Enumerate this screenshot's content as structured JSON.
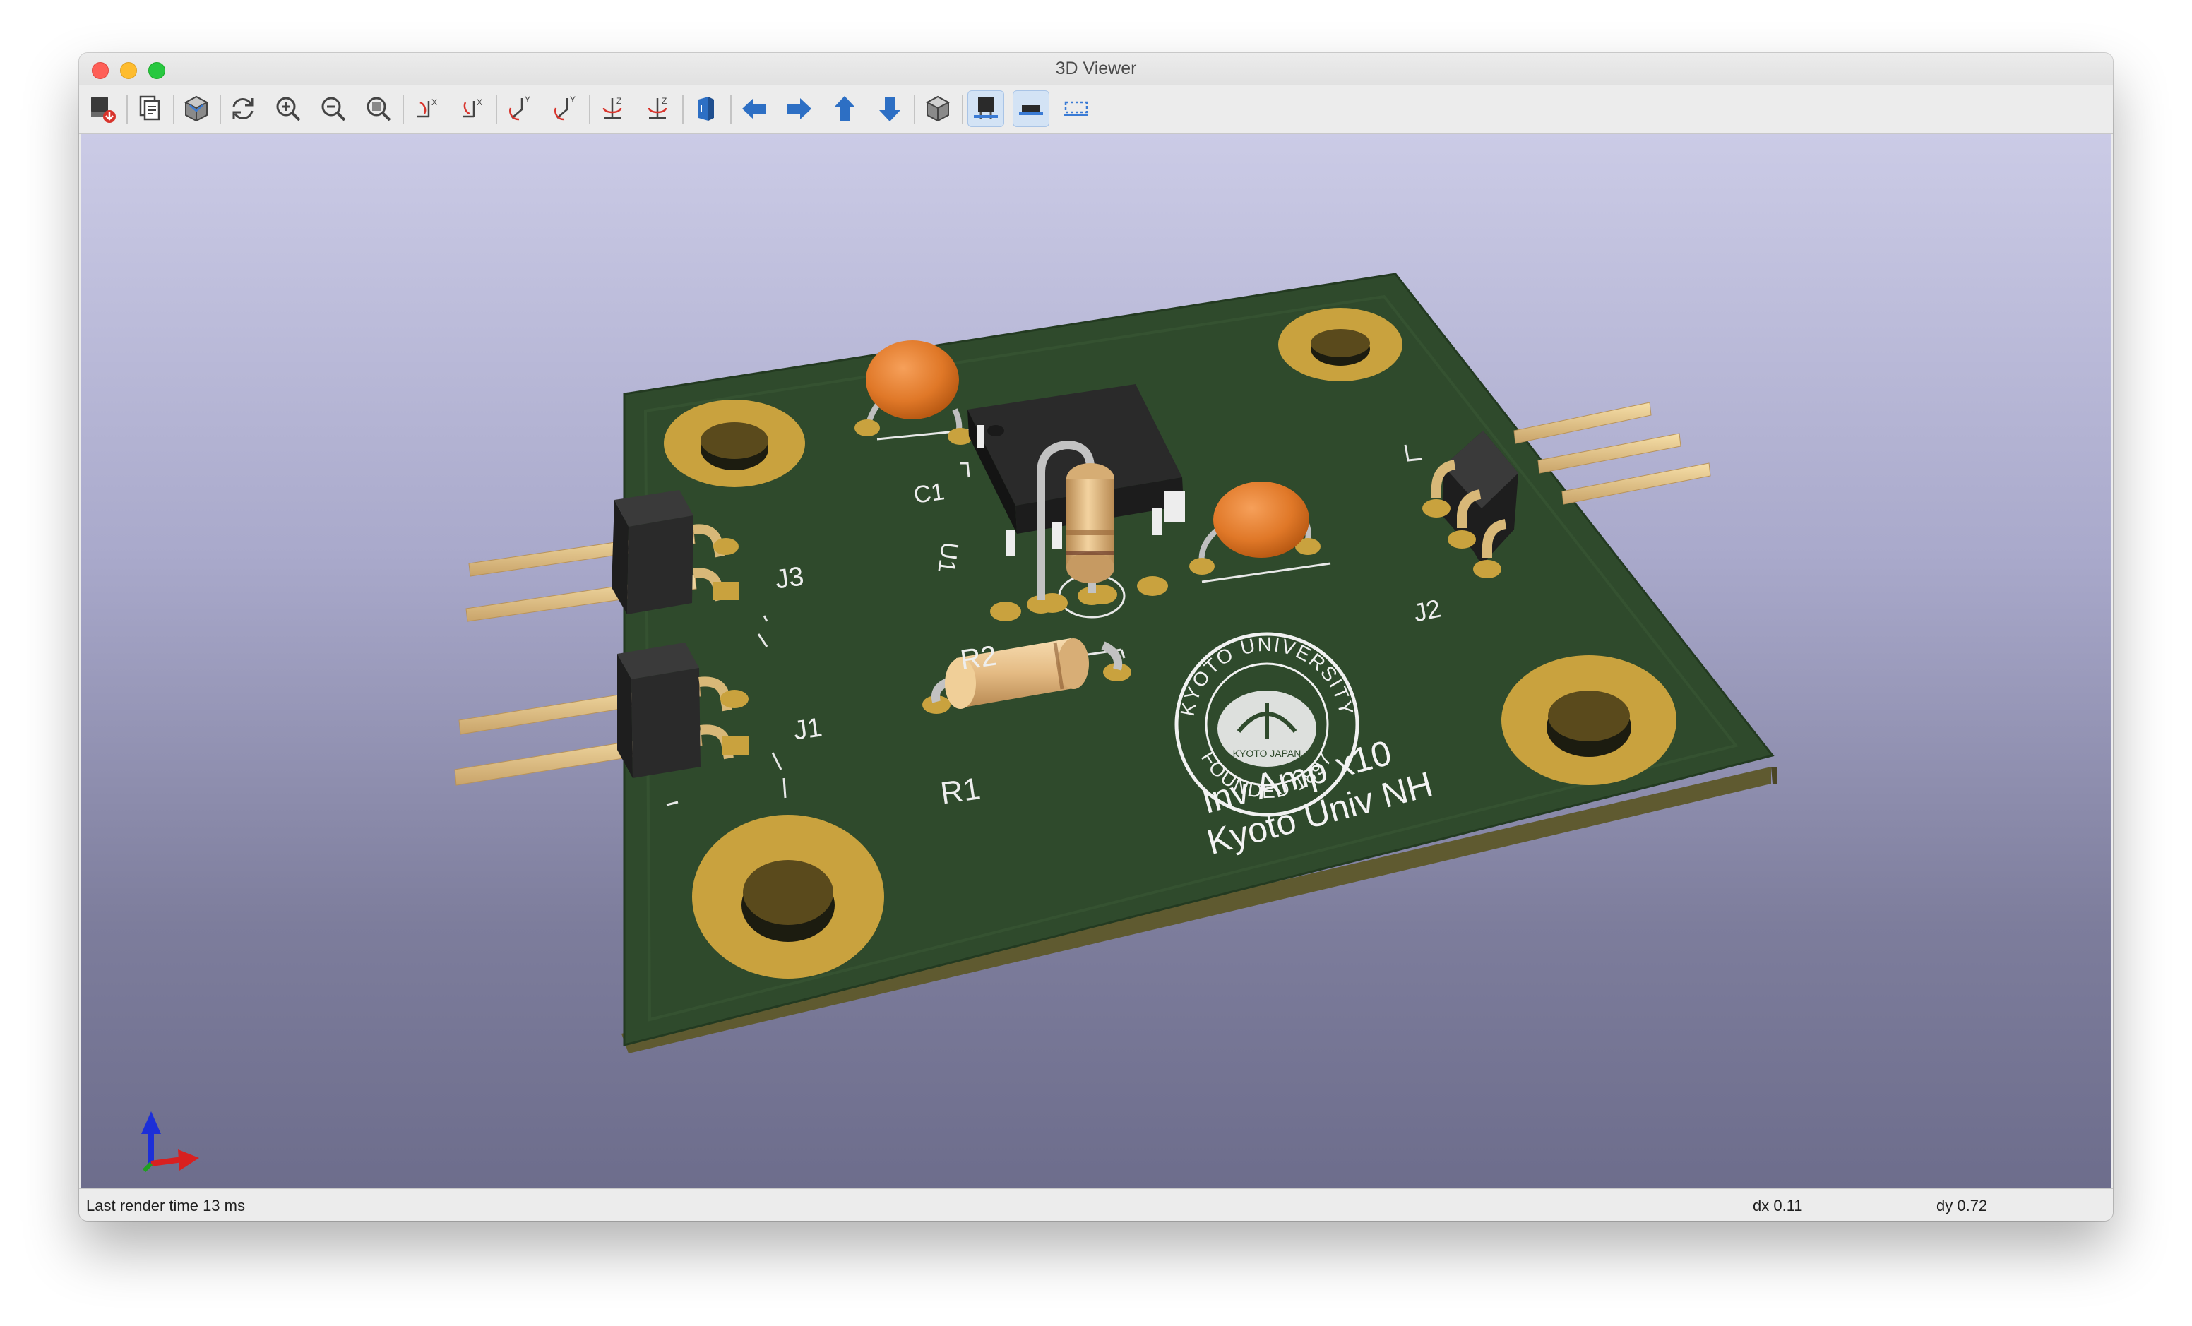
{
  "window": {
    "title": "3D Viewer"
  },
  "toolbar": {
    "buttons": [
      {
        "name": "export-image-icon"
      },
      {
        "name": "copy-clipboard-icon"
      },
      {
        "name": "raytrace-render-icon"
      },
      {
        "name": "reload-icon"
      },
      {
        "name": "zoom-in-icon"
      },
      {
        "name": "zoom-out-icon"
      },
      {
        "name": "zoom-fit-icon"
      },
      {
        "name": "rotate-x-cw-icon"
      },
      {
        "name": "rotate-x-ccw-icon"
      },
      {
        "name": "rotate-y-cw-icon"
      },
      {
        "name": "rotate-y-ccw-icon"
      },
      {
        "name": "rotate-z-cw-icon"
      },
      {
        "name": "rotate-z-ccw-icon"
      },
      {
        "name": "flip-board-icon"
      },
      {
        "name": "pan-left-icon"
      },
      {
        "name": "pan-right-icon"
      },
      {
        "name": "pan-up-icon"
      },
      {
        "name": "pan-down-icon"
      },
      {
        "name": "orthographic-icon"
      },
      {
        "name": "show-through-hole-icon",
        "active": true
      },
      {
        "name": "show-smd-icon",
        "active": true
      },
      {
        "name": "show-virtual-icon"
      }
    ]
  },
  "board": {
    "refs": {
      "c1": "C1",
      "u1": "U1",
      "j3": "J3",
      "j1": "J1",
      "j2": "J2",
      "r2": "R2",
      "r1": "R1"
    },
    "silk_line1": "Inv Amp x10",
    "silk_line2": "Kyoto Univ NH",
    "logo": {
      "ring_top": "KYOTO UNIVERSITY",
      "ring_bottom": "FOUNDED 1897",
      "inner": "KYOTO JAPAN"
    }
  },
  "colors": {
    "board": "#2f4a2c",
    "copper": "#c9a23e",
    "pins": "#e8c98e",
    "capacitor": "#e07828",
    "resistor": "#e4bb84"
  },
  "status": {
    "render_time": "Last render time 13 ms",
    "dx": "dx 0.11",
    "dy": "dy 0.72"
  }
}
